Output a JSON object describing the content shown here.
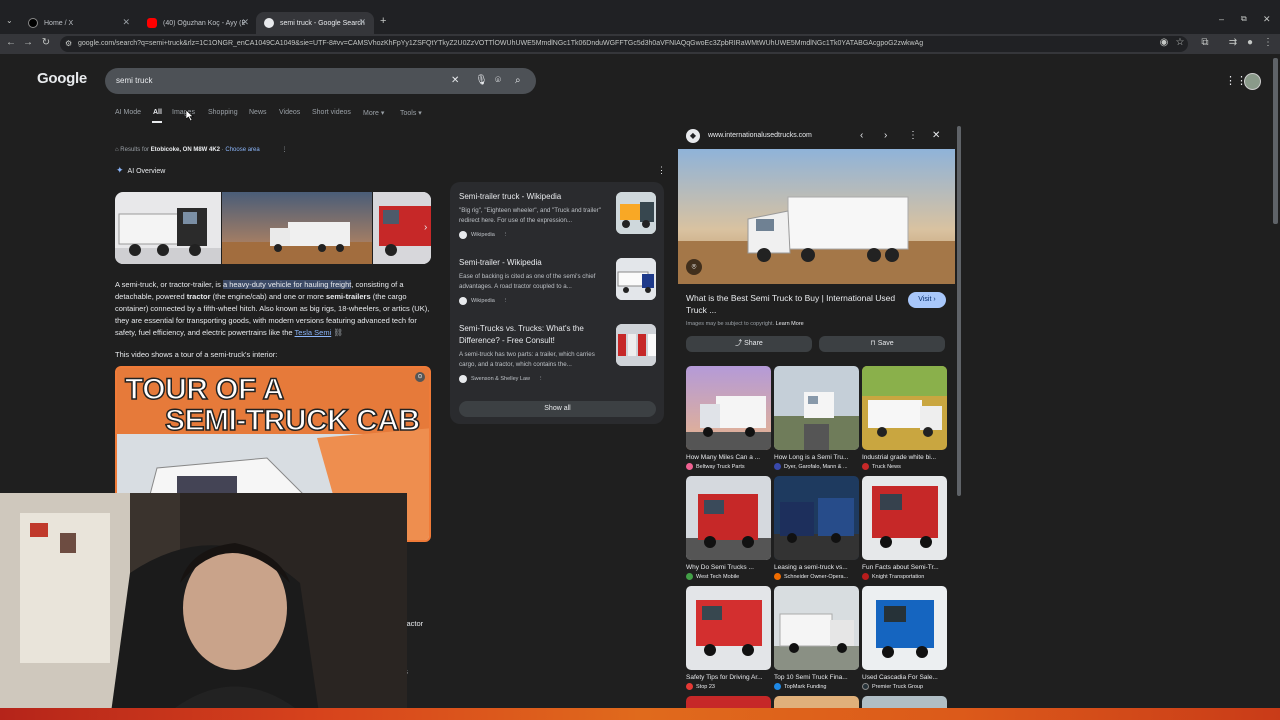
{
  "tabs": [
    {
      "title": "Home / X"
    },
    {
      "title": "(40) Oğuzhan Koç - Ayy (Be..."
    },
    {
      "title": "semi truck - Google Search"
    }
  ],
  "url": "google.com/search?q=semi+truck&rlz=1C1ONGR_enCA1049CA1049&sie=UTF-8#vv=CAMSVhozKhFpYy1ZSFQtYTkyZ2U0ZzVOTTlOWUhUWE5MmdlNGc1Tk06DnduWGFFTGc5d3h0aVFNIAQqGwoEc3ZpbRIRaWMtWUhUWE5MmdlNGc1Tk0YATABGAcgpoG2zwkwAg",
  "search": {
    "logo": "Google",
    "query": "semi truck"
  },
  "nav_tabs": [
    "AI Mode",
    "All",
    "Images",
    "Shopping",
    "News",
    "Videos",
    "Short videos",
    "More",
    "Tools"
  ],
  "location": {
    "prefix": "Results for",
    "place": "Etobicoke, ON M8W 4K2",
    "link": "Choose area"
  },
  "ai_overview": {
    "label": "AI Overview",
    "p1": "A semi-truck, or tractor-trailer, is",
    "p1_highlight": "a heavy-duty vehicle for hauling freight",
    "p2": ", consisting of a detachable, powered",
    "p2_b1": "tractor",
    "p3": "(the engine/cab) and one or more",
    "p3_b2": "semi-trailers",
    "p4": "(the cargo container) connected by a fifth-wheel hitch. Also known as big rigs, 18-wheelers, or artics (UK), they are essential for transporting goods, with modern versions featuring advanced tech for safety, fuel efficiency, and electric powertrains like the",
    "p4_link": "Tesla Semi",
    "video_note": "This video shows a tour of a semi-truck's interior:",
    "video_title_1": "TOUR OF A",
    "video_title_2": "SEMI-TRUCK CAB",
    "partial_1": "ractor",
    "partial_2": "s"
  },
  "sources": [
    {
      "title": "Semi-trailer truck - Wikipedia",
      "snippet": "\"Big rig\", \"Eighteen wheeler\", and \"Truck and trailer\" redirect here. For use of the expression...",
      "site": "Wikipedia"
    },
    {
      "title": "Semi-trailer - Wikipedia",
      "snippet": "Ease of backing is cited as one of the semi's chief advantages. A road tractor coupled to a...",
      "site": "Wikipedia"
    },
    {
      "title": "Semi-Trucks vs. Trucks: What's the Difference? - Free Consult!",
      "snippet": "A semi-truck has two parts: a trailer, which carries cargo, and a tractor, which contains the...",
      "site": "Swenson & Shelley Law"
    }
  ],
  "show_all": "Show all",
  "panel": {
    "site": "www.internationalusedtrucks.com",
    "title": "What is the Best Semi Truck to Buy | International Used Truck ...",
    "visit": "Visit",
    "copyright_prefix": "Images may be subject to copyright.",
    "learn_more": "Learn More",
    "share": "Share",
    "save": "Save"
  },
  "related_images": [
    {
      "caption": "How Many Miles Can a ...",
      "source": "Beltway Truck Parts"
    },
    {
      "caption": "How Long is a Semi Tru...",
      "source": "Dyer, Garofalo, Mann & ..."
    },
    {
      "caption": "Industrial grade white bi...",
      "source": "Truck News"
    },
    {
      "caption": "Why Do Semi Trucks ...",
      "source": "West Tech Mobile"
    },
    {
      "caption": "Leasing a semi-truck vs...",
      "source": "Schneider Owner-Opera..."
    },
    {
      "caption": "Fun Facts about Semi-Tr...",
      "source": "Knight Transportation"
    },
    {
      "caption": "Safety Tips for Driving Ar...",
      "source": "Stop 23"
    },
    {
      "caption": "Top 10 Semi Truck Fina...",
      "source": "TopMark Funding"
    },
    {
      "caption": "Used Cascadia For Sale...",
      "source": "Premier Truck Group"
    }
  ]
}
